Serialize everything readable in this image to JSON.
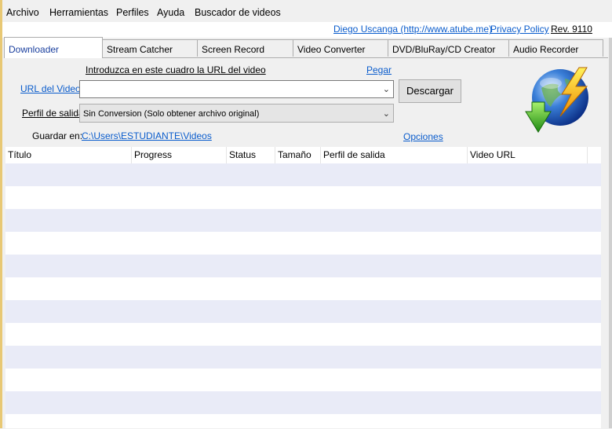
{
  "menu": {
    "items": [
      "Archivo",
      "Herramientas",
      "Perfiles",
      "Ayuda",
      "Buscador de videos"
    ]
  },
  "header_links": {
    "author": "Diego Uscanga (http://www.atube.me)",
    "privacy": "Privacy Policy",
    "revision": "Rev. 9110"
  },
  "tabs": [
    "Downloader",
    "Stream Catcher",
    "Screen Record",
    "Video Converter",
    "DVD/BluRay/CD Creator",
    "Audio Recorder"
  ],
  "active_tab": "Downloader",
  "downloader": {
    "instruction": "Introduzca en este cuadro la URL del video",
    "paste_link": "Pegar",
    "url_label": "URL del Video:",
    "url_value": "",
    "download_button": "Descargar",
    "profile_label": "Perfil de salida",
    "profile_value": "Sin Conversion (Solo obtener archivo original)",
    "save_label": "Guardar en:",
    "save_path": "C:\\Users\\ESTUDIANTE\\Videos",
    "options_link": "Opciones"
  },
  "table": {
    "columns": [
      "Título",
      "Progress",
      "Status",
      "Tamaño",
      "Perfil de salida",
      "Video URL"
    ],
    "rows": []
  },
  "colors": {
    "link": "#0a5ccc",
    "row_alt": "#e9ebf7",
    "active_tab_text": "#1a3f9e"
  }
}
